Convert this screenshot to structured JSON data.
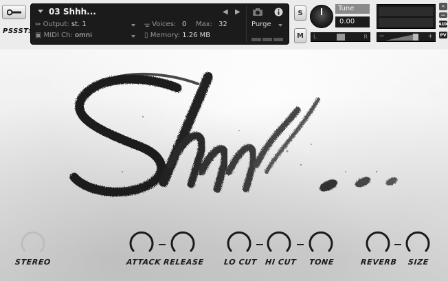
{
  "header": {
    "library_name": "PSSST:",
    "instrument_name": "03 Shhh...",
    "output_label": "Output:",
    "output_value": "st. 1",
    "midi_label": "MIDI Ch:",
    "midi_value": "omni",
    "voices_label": "Voices:",
    "voices_value": "0",
    "max_label": "Max:",
    "max_value": "32",
    "memory_label": "Memory:",
    "memory_value": "1.26 MB",
    "purge_label": "Purge",
    "solo_label": "S",
    "mute_label": "M",
    "tune_label": "Tune",
    "tune_value": "0.00",
    "pan_left": "L",
    "pan_right": "R",
    "aux_label": "AUX",
    "pv_label": "PV"
  },
  "controls": [
    {
      "id": "stereo",
      "label": "STEREO"
    },
    {
      "id": "attack",
      "label": "ATTACK"
    },
    {
      "id": "release",
      "label": "RELEASE"
    },
    {
      "id": "locut",
      "label": "LO CUT"
    },
    {
      "id": "hicut",
      "label": "HI CUT"
    },
    {
      "id": "tone",
      "label": "TONE"
    },
    {
      "id": "reverb",
      "label": "REVERB"
    },
    {
      "id": "size",
      "label": "SIZE"
    }
  ],
  "colors": {
    "panel_dark": "#1b1b1b",
    "knob_ring": "#1a1a1a",
    "label_text": "#1a1a1a"
  },
  "icons": [
    "wrench-icon",
    "camera-icon",
    "info-icon",
    "close-icon",
    "minimize-icon"
  ]
}
